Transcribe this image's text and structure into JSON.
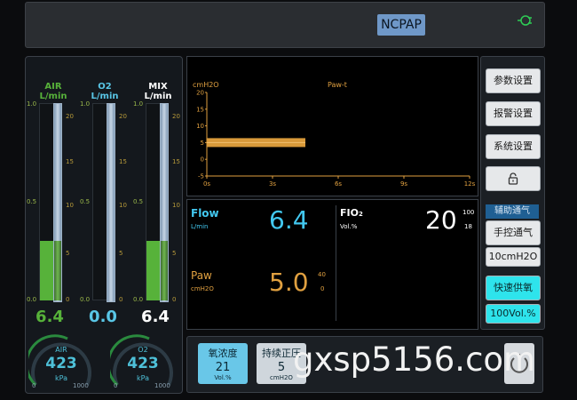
{
  "topbar": {
    "mode": "NCPAP",
    "power_icon": "plug-icon"
  },
  "meters": [
    {
      "name": "AIR",
      "unit": "L/min",
      "value": "6.4",
      "color": "#57b23a",
      "left_ticks": [
        "1.0",
        "0.5",
        "0.0"
      ],
      "right_ticks": [
        "20",
        "15",
        "10",
        "5",
        "0"
      ]
    },
    {
      "name": "O2",
      "unit": "L/min",
      "value": "0.0",
      "color": "#59c6e6",
      "left_ticks": [
        "1.0",
        "0.5",
        "0.0"
      ],
      "right_ticks": [
        "20",
        "15",
        "10",
        "5",
        "0"
      ]
    },
    {
      "name": "MIX",
      "unit": "L/min",
      "value": "6.4",
      "color": "#ffffff",
      "left_ticks": [
        "1.0",
        "0.5",
        "0.0"
      ],
      "right_ticks": [
        "20",
        "15",
        "10",
        "5",
        "0"
      ]
    }
  ],
  "meter_levels": [
    0.3,
    0.0,
    0.3
  ],
  "gauges": [
    {
      "label": "AIR",
      "value": "423",
      "unit": "kPa",
      "min": "0",
      "max": "1000"
    },
    {
      "label": "O2",
      "value": "423",
      "unit": "kPa",
      "min": "0",
      "max": "1000"
    }
  ],
  "chart": {
    "unit_label": "cmH2O",
    "title": "Paw-t",
    "y_ticks": [
      "20",
      "15",
      "10",
      "5",
      "0",
      "-5"
    ],
    "x_ticks": [
      "0s",
      "3s",
      "6s",
      "9s",
      "12s"
    ]
  },
  "chart_data": {
    "type": "line",
    "title": "Paw-t",
    "ylabel": "cmH2O",
    "xlabel": "",
    "x_ticks": [
      "0s",
      "3s",
      "6s",
      "9s",
      "12s"
    ],
    "ylim": [
      -5,
      20
    ],
    "xlim": [
      0,
      12
    ],
    "series": [
      {
        "x": [
          0,
          4.5,
          4.9,
          12
        ],
        "y": [
          5,
          5,
          null,
          5
        ]
      }
    ]
  },
  "readouts": {
    "flow": {
      "label": "Flow",
      "unit": "L/min",
      "value": "6.4"
    },
    "paw": {
      "label": "Paw",
      "unit": "cmH2O",
      "value": "5.0",
      "high": "40",
      "low": "0"
    },
    "fio2": {
      "label": "FIO",
      "label_sub": "2",
      "unit": "Vol.%",
      "value": "20",
      "high": "100",
      "low": "18"
    }
  },
  "side_menu": {
    "param_settings": "参数设置",
    "alarm_settings": "报警设置",
    "system_settings": "系统设置",
    "lock_icon": "lock-icon",
    "assist_section": "辅助通气",
    "manual_vent": "手控通气",
    "manual_value": "10cmH2O",
    "rapid_oxygen": "快速供氧",
    "rapid_value": "100Vol.%"
  },
  "controls": [
    {
      "title": "氧浓度",
      "value": "21",
      "unit": "Vol.%"
    },
    {
      "title": "持续正压",
      "value": "5",
      "unit": "cmH2O"
    }
  ],
  "watermark": "gxsp5156.com"
}
